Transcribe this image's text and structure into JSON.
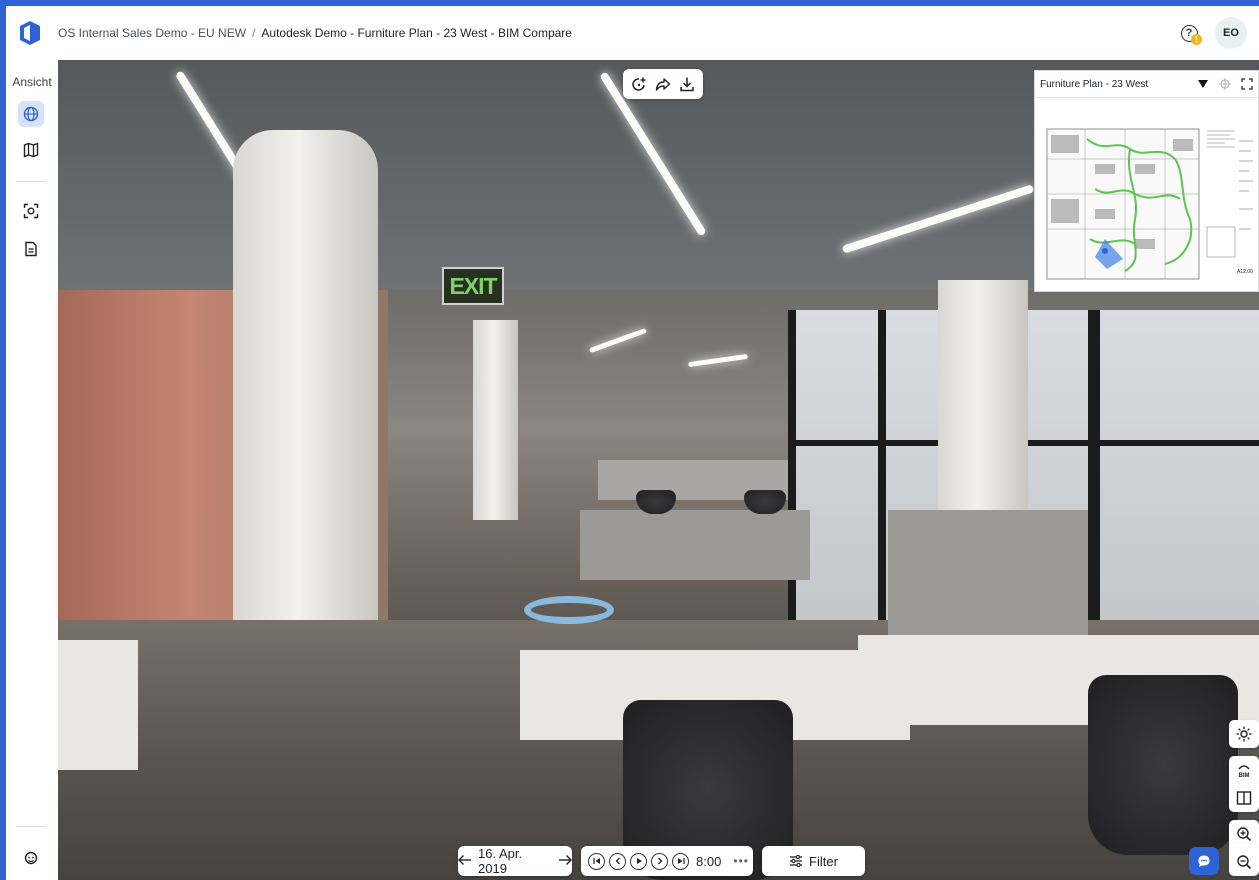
{
  "header": {
    "breadcrumb": {
      "project": "OS Internal Sales Demo - EU NEW",
      "separator": "/",
      "current": "Autodesk Demo - Furniture Plan - 23 West - BIM Compare"
    },
    "help_badge": "!",
    "user_initials": "EO"
  },
  "sidebar": {
    "label": "Ansicht",
    "items": [
      {
        "name": "globe-icon",
        "active": true
      },
      {
        "name": "map-icon",
        "active": false
      },
      {
        "name": "capture-icon",
        "active": false
      },
      {
        "name": "document-icon",
        "active": false
      },
      {
        "name": "support-icon",
        "active": false
      }
    ]
  },
  "viewer": {
    "exit_sign": "EXIT",
    "toolbar": [
      "add-capture-icon",
      "share-icon",
      "download-icon"
    ]
  },
  "minimap": {
    "title": "Furniture Plan - 23 West",
    "sheet_id": "A12.00"
  },
  "controls": {
    "date": "16. Apr. 2019",
    "time": "8:00",
    "more": "•••",
    "filter_label": "Filter"
  },
  "colors": {
    "accent": "#2e63d6",
    "active_bg": "#d7e3fb",
    "badge": "#f3b51a",
    "path_green": "#5bc44f"
  }
}
